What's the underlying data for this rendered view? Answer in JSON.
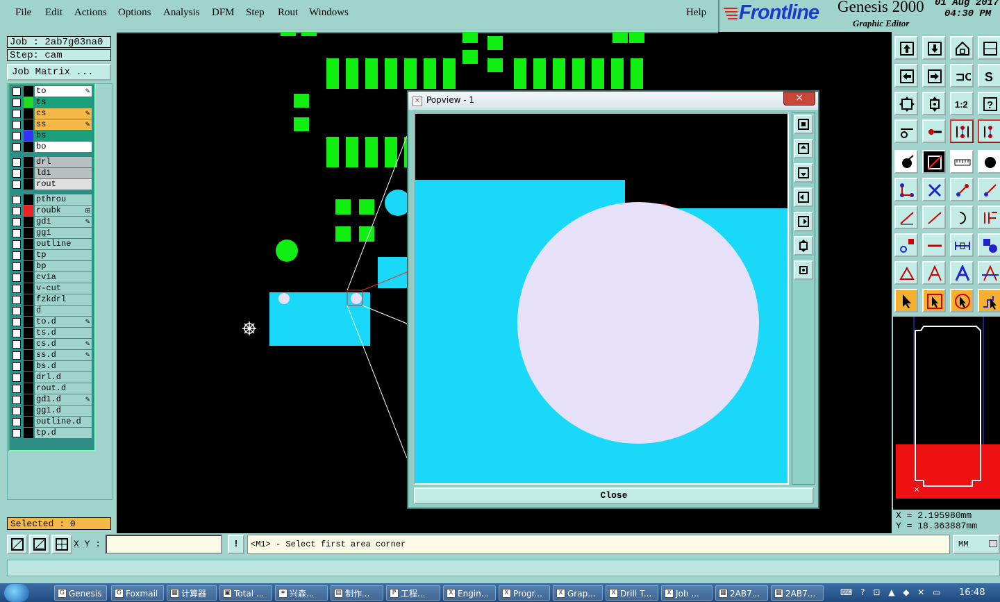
{
  "menubar": {
    "items": [
      "File",
      "Edit",
      "Actions",
      "Options",
      "Analysis",
      "DFM",
      "Step",
      "Rout",
      "Windows"
    ],
    "help": "Help"
  },
  "brand": {
    "logo": "Frontline",
    "product": "Genesis 2000",
    "subtitle": "Graphic Editor",
    "date": "01 Aug 2017",
    "time": "04:30 PM"
  },
  "job": {
    "job_label": "Job : 2ab7g03na0",
    "step_label": "Step: cam",
    "matrix_button": "Job Matrix ..."
  },
  "layers": [
    {
      "name": "to",
      "color": "#ffffff",
      "swatch": "#000000",
      "icon": "pen"
    },
    {
      "name": "ts",
      "color": "#1aa07a",
      "swatch": "#22dd22",
      "icon": ""
    },
    {
      "name": "cs",
      "color": "#f5b94a",
      "swatch": "#000000",
      "icon": "pen"
    },
    {
      "name": "ss",
      "color": "#f5b94a",
      "swatch": "#000000",
      "icon": "pen"
    },
    {
      "name": "bs",
      "color": "#1aa07a",
      "swatch": "#3333ff",
      "icon": ""
    },
    {
      "name": "bo",
      "color": "#ffffff",
      "swatch": "#000000",
      "icon": ""
    },
    {
      "name": "drl",
      "color": "#b9c0c0",
      "swatch": "#000000",
      "icon": ""
    },
    {
      "name": "ldi",
      "color": "#b9c0c0",
      "swatch": "#000000",
      "icon": ""
    },
    {
      "name": "rout",
      "color": "#e0e0e0",
      "swatch": "#000000",
      "icon": ""
    },
    {
      "name": "pthrou",
      "color": "#9fd3cc",
      "swatch": "#000000",
      "icon": ""
    },
    {
      "name": "roubk",
      "color": "#9fd3cc",
      "swatch": "#ee2222",
      "icon": "grid"
    },
    {
      "name": "gd1",
      "color": "#9fd3cc",
      "swatch": "#000000",
      "icon": "pen"
    },
    {
      "name": "gg1",
      "color": "#9fd3cc",
      "swatch": "#000000",
      "icon": ""
    },
    {
      "name": "outline",
      "color": "#9fd3cc",
      "swatch": "#000000",
      "icon": ""
    },
    {
      "name": "tp",
      "color": "#9fd3cc",
      "swatch": "#000000",
      "icon": ""
    },
    {
      "name": "bp",
      "color": "#9fd3cc",
      "swatch": "#000000",
      "icon": ""
    },
    {
      "name": "cvia",
      "color": "#9fd3cc",
      "swatch": "#000000",
      "icon": ""
    },
    {
      "name": "v-cut",
      "color": "#9fd3cc",
      "swatch": "#000000",
      "icon": ""
    },
    {
      "name": "fzkdrl",
      "color": "#9fd3cc",
      "swatch": "#000000",
      "icon": ""
    },
    {
      "name": "d",
      "color": "#9fd3cc",
      "swatch": "#000000",
      "icon": ""
    },
    {
      "name": "to.d",
      "color": "#9fd3cc",
      "swatch": "#000000",
      "icon": "pen"
    },
    {
      "name": "ts.d",
      "color": "#9fd3cc",
      "swatch": "#000000",
      "icon": ""
    },
    {
      "name": "cs.d",
      "color": "#9fd3cc",
      "swatch": "#000000",
      "icon": "pen"
    },
    {
      "name": "ss.d",
      "color": "#9fd3cc",
      "swatch": "#000000",
      "icon": "pen"
    },
    {
      "name": "bs.d",
      "color": "#9fd3cc",
      "swatch": "#000000",
      "icon": ""
    },
    {
      "name": "drl.d",
      "color": "#9fd3cc",
      "swatch": "#000000",
      "icon": ""
    },
    {
      "name": "rout.d",
      "color": "#9fd3cc",
      "swatch": "#000000",
      "icon": ""
    },
    {
      "name": "gd1.d",
      "color": "#9fd3cc",
      "swatch": "#000000",
      "icon": "pen"
    },
    {
      "name": "gg1.d",
      "color": "#9fd3cc",
      "swatch": "#000000",
      "icon": ""
    },
    {
      "name": "outline.d",
      "color": "#9fd3cc",
      "swatch": "#000000",
      "icon": ""
    },
    {
      "name": "tp.d",
      "color": "#9fd3cc",
      "swatch": "#000000",
      "icon": ""
    }
  ],
  "selected": "Selected : 0",
  "coords": {
    "x": "X = 2.195980mm",
    "y": "Y = 18.363887mm"
  },
  "status": {
    "xy_label": "X Y :",
    "xy_value": "",
    "exclaim": "!",
    "prompt": "<M1> - Select first area corner",
    "units": "MM"
  },
  "popview": {
    "title": "Popview - 1",
    "close_x": "×",
    "close_button": "Close"
  },
  "taskbar": [
    {
      "label": "Genesis",
      "icon": "G"
    },
    {
      "label": "Foxmail",
      "icon": "G"
    },
    {
      "label": "计算器",
      "icon": "▦"
    },
    {
      "label": "Total ...",
      "icon": "▣"
    },
    {
      "label": "兴森...",
      "icon": "✶"
    },
    {
      "label": "制作...",
      "icon": "▤"
    },
    {
      "label": "工程...",
      "icon": "P"
    },
    {
      "label": "Engin...",
      "icon": "X"
    },
    {
      "label": "Progr...",
      "icon": "X"
    },
    {
      "label": "Grap...",
      "icon": "X"
    },
    {
      "label": "Drill T...",
      "icon": "X"
    },
    {
      "label": "Job ...",
      "icon": "X"
    },
    {
      "label": "2AB7...",
      "icon": "▦"
    },
    {
      "label": "2AB7...",
      "icon": "▦"
    }
  ],
  "clock": "16:48",
  "colors": {
    "panel": "#9fd3cc",
    "pad_green": "#11ee11",
    "copper_cyan": "#19d8f8",
    "hole_lavender": "#e6e0f8",
    "highlight_red": "#ee1111"
  }
}
